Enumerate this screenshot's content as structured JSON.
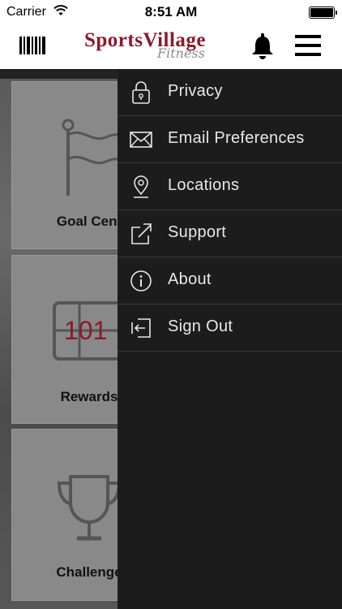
{
  "status_bar": {
    "carrier": "Carrier",
    "time": "8:51 AM"
  },
  "header": {
    "logo_main": "SportsVillage",
    "logo_sub": "Fitness"
  },
  "tiles": [
    {
      "label": "Goal Cent",
      "icon": "flag-icon"
    },
    {
      "label": "Rewards",
      "icon": "rewards-counter-icon",
      "counter": "101"
    },
    {
      "label": "Challenge",
      "icon": "trophy-icon"
    }
  ],
  "drawer": {
    "items": [
      {
        "label": "Privacy",
        "icon": "lock-icon"
      },
      {
        "label": "Email Preferences",
        "icon": "envelope-icon"
      },
      {
        "label": "Locations",
        "icon": "location-pin-icon"
      },
      {
        "label": "Support",
        "icon": "external-link-icon"
      },
      {
        "label": "About",
        "icon": "info-icon"
      },
      {
        "label": "Sign Out",
        "icon": "sign-out-icon"
      }
    ]
  },
  "colors": {
    "brand": "#8b1a2a",
    "drawer_bg": "#1c1c1c",
    "drawer_text": "#e8e8e8"
  }
}
